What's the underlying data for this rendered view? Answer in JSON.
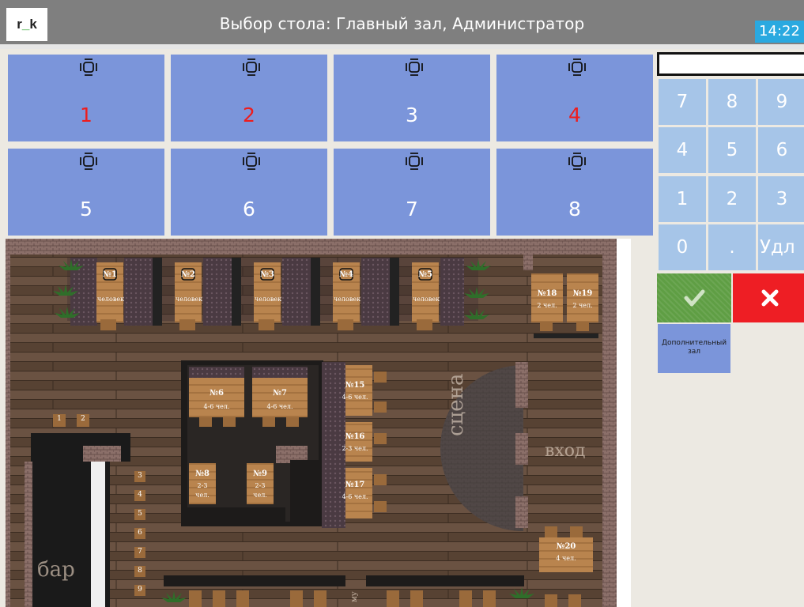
{
  "header": {
    "logo_text_left": "r",
    "logo_text_sep": "_",
    "logo_text_right": "k",
    "title": "Выбор стола: Главный зал, Администратор",
    "clock": "14:22"
  },
  "tables": [
    {
      "number": "1",
      "occupied": true
    },
    {
      "number": "2",
      "occupied": true
    },
    {
      "number": "3",
      "occupied": false
    },
    {
      "number": "4",
      "occupied": true
    },
    {
      "number": "5",
      "occupied": false
    },
    {
      "number": "6",
      "occupied": false
    },
    {
      "number": "7",
      "occupied": false
    },
    {
      "number": "8",
      "occupied": false
    }
  ],
  "keypad": {
    "display_value": "",
    "keys": [
      "7",
      "8",
      "9",
      "4",
      "5",
      "6",
      "1",
      "2",
      "3",
      "0",
      ".",
      "Удл"
    ],
    "extra_hall_label_1": "Дополнительный",
    "extra_hall_label_2": "зал"
  },
  "floor_plan": {
    "top_tables": [
      {
        "no": "№1",
        "cap": "человек"
      },
      {
        "no": "№2",
        "cap": "человек"
      },
      {
        "no": "№3",
        "cap": "человек"
      },
      {
        "no": "№4",
        "cap": "человек"
      },
      {
        "no": "№5",
        "cap": "человек"
      }
    ],
    "t18": {
      "no": "№18",
      "cap": "2 чел."
    },
    "t19": {
      "no": "№19",
      "cap": "2 чел."
    },
    "t6": {
      "no": "№6",
      "cap": "4-6 чел."
    },
    "t7": {
      "no": "№7",
      "cap": "4-6 чел."
    },
    "t15": {
      "no": "№15",
      "cap": "4-6 чел."
    },
    "t16": {
      "no": "№16",
      "cap": "2-3 чел."
    },
    "t17": {
      "no": "№17",
      "cap": "4-6 чел."
    },
    "t8": {
      "no": "№8",
      "cap1": "2-3",
      "cap2": "чел."
    },
    "t9": {
      "no": "№9",
      "cap1": "2-3",
      "cap2": "чел."
    },
    "t20": {
      "no": "№20",
      "cap": "4 чел."
    },
    "bar_seats": [
      "1",
      "2",
      "3",
      "4",
      "5",
      "6",
      "7",
      "8",
      "9"
    ],
    "stage_label": "сцена",
    "entrance_label": "вход",
    "bar_label": "бар",
    "wc_label": "му"
  },
  "colors": {
    "tile": "#7b95da",
    "occupied_number": "#ee1c1c",
    "keypad_key": "#a6c5e8",
    "header": "#7f7f7f",
    "clock": "#2aa9e0",
    "ok": "#5f9e44",
    "cancel": "#ee1e24"
  },
  "icons": {
    "table": "table-with-chairs-icon",
    "confirm": "checkmark-icon",
    "cancel": "close-icon"
  }
}
